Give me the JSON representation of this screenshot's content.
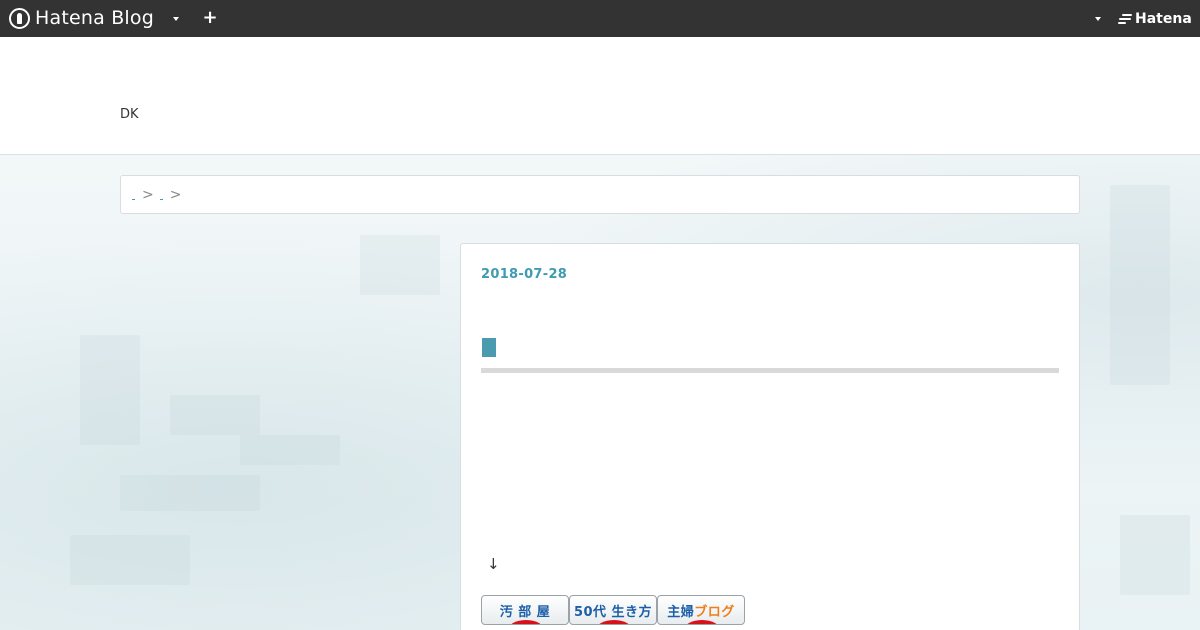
{
  "topbar": {
    "brand_text": "Hatena Blog",
    "add_button_label": "+",
    "hatena_text": "Hatena"
  },
  "header": {
    "blog_title": "DK"
  },
  "breadcrumb": {
    "separator": ">"
  },
  "entry": {
    "date": "2018-07-28",
    "down_arrow": "↓",
    "ranking_badges": [
      {
        "text": "汚 部 屋"
      },
      {
        "text": "50代 生き方"
      },
      {
        "text_main": "主婦",
        "text_accent": "ブログ"
      }
    ]
  },
  "colors": {
    "topbar_bg": "#333333",
    "accent": "#3e9bb0",
    "badge_red": "#d8121b",
    "badge_blue": "#1c5ea8",
    "badge_orange": "#ef7d1a"
  },
  "icons": [
    "hatena-blog-logo-icon",
    "chevron-down-icon",
    "plus-icon",
    "hatena-logo-icon"
  ]
}
